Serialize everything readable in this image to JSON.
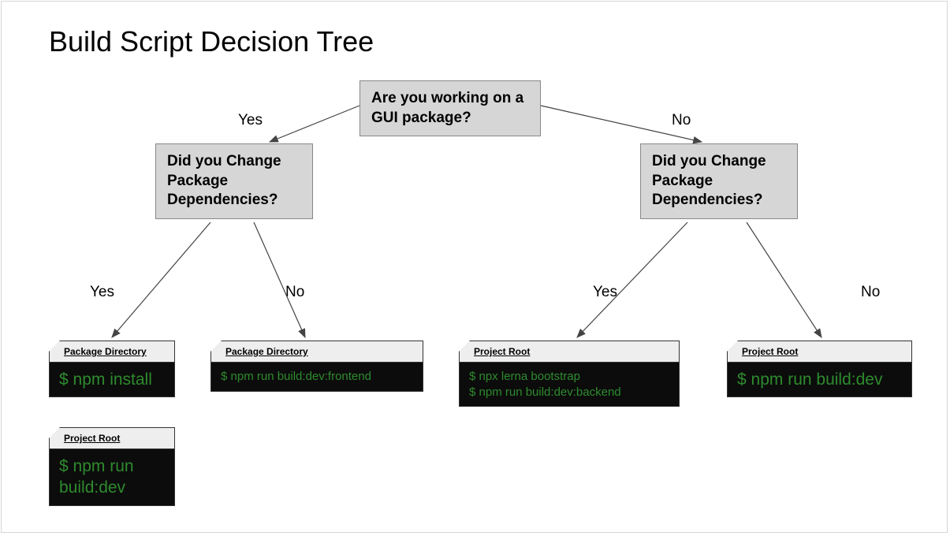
{
  "title": "Build Script Decision Tree",
  "nodes": {
    "root": {
      "text": "Are you working on a GUI package?"
    },
    "left": {
      "text": "Did you Change Package Dependencies?"
    },
    "right": {
      "text": "Did you Change Package Dependencies?"
    }
  },
  "edges": {
    "root_left": "Yes",
    "root_right": "No",
    "left_yes": "Yes",
    "left_no": "No",
    "right_yes": "Yes",
    "right_no": "No"
  },
  "terminals": {
    "t1": {
      "header": "Package Directory",
      "commands": [
        "$ npm install"
      ]
    },
    "t2": {
      "header": "Project Root",
      "commands": [
        "$ npm run build:dev"
      ]
    },
    "t3": {
      "header": "Package Directory",
      "commands": [
        "$ npm run build:dev:frontend"
      ]
    },
    "t4": {
      "header": "Project Root",
      "commands": [
        "$ npx lerna bootstrap",
        "$ npm run build:dev:backend"
      ]
    },
    "t5": {
      "header": "Project Root",
      "commands": [
        "$ npm run build:dev"
      ]
    }
  },
  "chart_data": {
    "type": "decision-tree",
    "root": {
      "question": "Are you working on a GUI package?",
      "branches": [
        {
          "answer": "Yes",
          "node": {
            "question": "Did you Change Package Dependencies?",
            "branches": [
              {
                "answer": "Yes",
                "actions": [
                  {
                    "location": "Package Directory",
                    "commands": [
                      "npm install"
                    ]
                  },
                  {
                    "location": "Project Root",
                    "commands": [
                      "npm run build:dev"
                    ]
                  }
                ]
              },
              {
                "answer": "No",
                "actions": [
                  {
                    "location": "Package Directory",
                    "commands": [
                      "npm run build:dev:frontend"
                    ]
                  }
                ]
              }
            ]
          }
        },
        {
          "answer": "No",
          "node": {
            "question": "Did you Change Package Dependencies?",
            "branches": [
              {
                "answer": "Yes",
                "actions": [
                  {
                    "location": "Project Root",
                    "commands": [
                      "npx lerna bootstrap",
                      "npm run build:dev:backend"
                    ]
                  }
                ]
              },
              {
                "answer": "No",
                "actions": [
                  {
                    "location": "Project Root",
                    "commands": [
                      "npm run build:dev"
                    ]
                  }
                ]
              }
            ]
          }
        }
      ]
    }
  }
}
